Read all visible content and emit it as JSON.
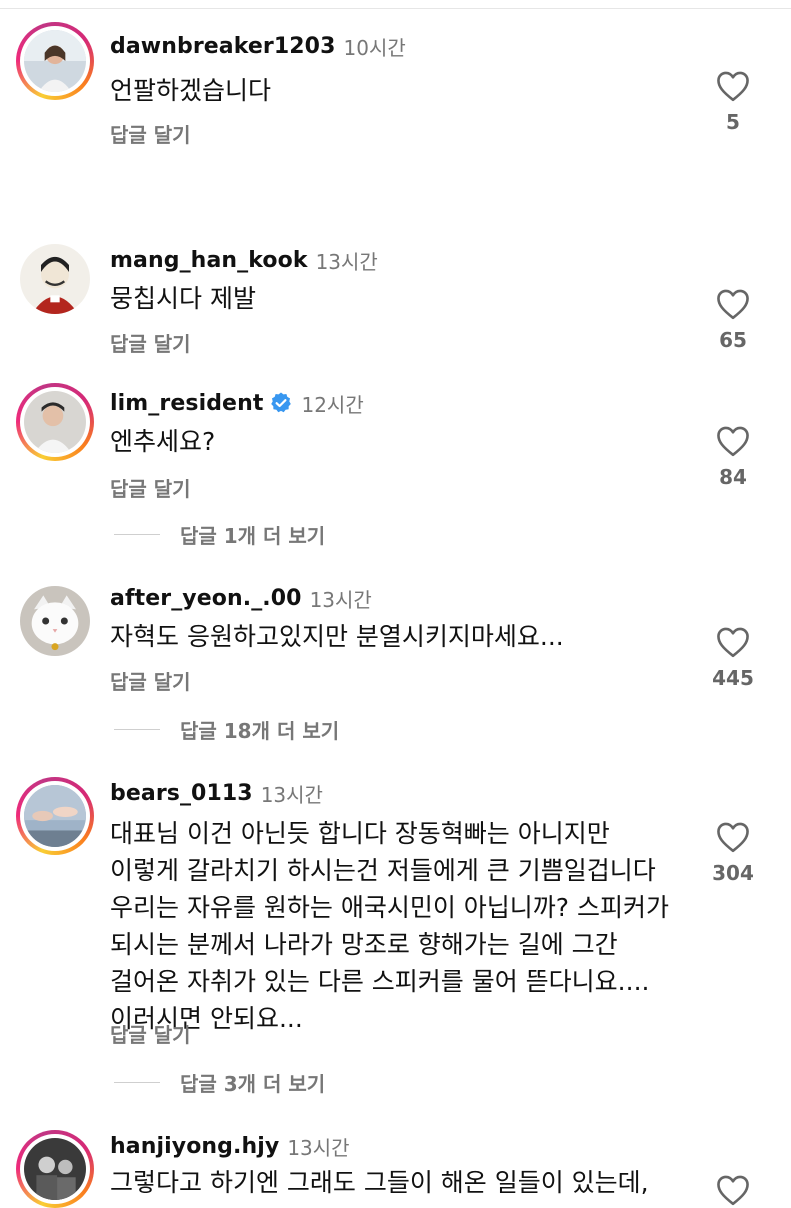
{
  "comments": [
    {
      "username": "dawnbreaker1203",
      "time": "10시간",
      "verified": false,
      "text": "언팔하겠습니다",
      "reply_label": "답글 달기",
      "likes": "5",
      "story_ring": true
    },
    {
      "username": "mang_han_kook",
      "time": "13시간",
      "verified": false,
      "text": "뭉칩시다 제발",
      "reply_label": "답글 달기",
      "likes": "65",
      "story_ring": false
    },
    {
      "username": "lim_resident",
      "time": "12시간",
      "verified": true,
      "text": "엔추세요?",
      "reply_label": "답글 달기",
      "likes": "84",
      "story_ring": true,
      "view_replies": "답글 1개 더 보기"
    },
    {
      "username": "after_yeon._.00",
      "time": "13시간",
      "verified": false,
      "text": "자혁도 응원하고있지만 분열시키지마세요...",
      "reply_label": "답글 달기",
      "likes": "445",
      "story_ring": false,
      "view_replies": "답글 18개 더 보기"
    },
    {
      "username": "bears_0113",
      "time": "13시간",
      "verified": false,
      "text": "대표님 이건 아닌듯 합니다 장동혁빠는 아니지만 이렇게 갈라치기 하시는건 저들에게 큰 기쁨일겁니다 우리는 자유를 원하는 애국시민이 아닙니까? 스피커가 되시는 분께서 나라가 망조로 향해가는 길에 그간 걸어온 자취가 있는 다른 스피커를 물어 뜯다니요.... 이러시면 안되요...",
      "reply_label": "답글 달기",
      "likes": "304",
      "story_ring": true,
      "view_replies": "답글 3개 더 보기"
    },
    {
      "username": "hanjiyong.hjy",
      "time": "13시간",
      "verified": false,
      "text": "그렇다고 하기엔 그래도 그들이 해온 일들이 있는데,",
      "story_ring": true
    }
  ],
  "colors": {
    "story_ring": "#ee2a7b",
    "verified": "#3897f0",
    "secondary_text": "#777777"
  },
  "icons": {
    "like": "heart-outline-icon",
    "verified": "verified-badge-icon"
  }
}
